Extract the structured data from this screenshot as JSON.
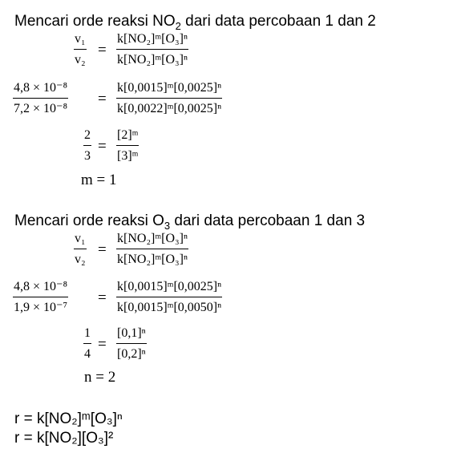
{
  "section1": {
    "heading_pre": "Mencari orde reaksi NO",
    "heading_sub": "2",
    "heading_post": " dari data percobaan 1 dan 2",
    "ratio_num": "v₁",
    "ratio_den": "v₂",
    "rate_law_num": "k[NO₂]ᵐ[O₃]ⁿ",
    "rate_law_den": "k[NO₂]ᵐ[O₃]ⁿ",
    "lhs_num": "4,8 × 10⁻⁸",
    "lhs_den": "7,2 × 10⁻⁸",
    "rhs_num": "k[0,0015]ᵐ[0,0025]ⁿ",
    "rhs_den": "k[0,0022]ᵐ[0,0025]ⁿ",
    "simp_num": "2",
    "simp_den": "3",
    "simp_rhs_num": "[2]ᵐ",
    "simp_rhs_den": "[3]ᵐ",
    "result": "m = 1"
  },
  "section2": {
    "heading_pre": "Mencari orde reaksi O",
    "heading_sub": "3",
    "heading_post": " dari data percobaan 1 dan 3",
    "ratio_num": "v₁",
    "ratio_den": "v₂",
    "rate_law_num": "k[NO₂]ᵐ[O₃]ⁿ",
    "rate_law_den": "k[NO₂]ᵐ[O₃]ⁿ",
    "lhs_num": "4,8 × 10⁻⁸",
    "lhs_den": "1,9 × 10⁻⁷",
    "rhs_num": "k[0,0015]ᵐ[0,0025]ⁿ",
    "rhs_den": "k[0,0015]ᵐ[0,0050]ⁿ",
    "simp_num": "1",
    "simp_den": "4",
    "simp_rhs_num": "[0,1]ⁿ",
    "simp_rhs_den": "[0,2]ⁿ",
    "result": "n = 2"
  },
  "conclusion": {
    "line1": "r = k[NO₂]ᵐ[O₃]ⁿ",
    "line2": "r = k[NO₂][O₃]²"
  },
  "equals": "="
}
